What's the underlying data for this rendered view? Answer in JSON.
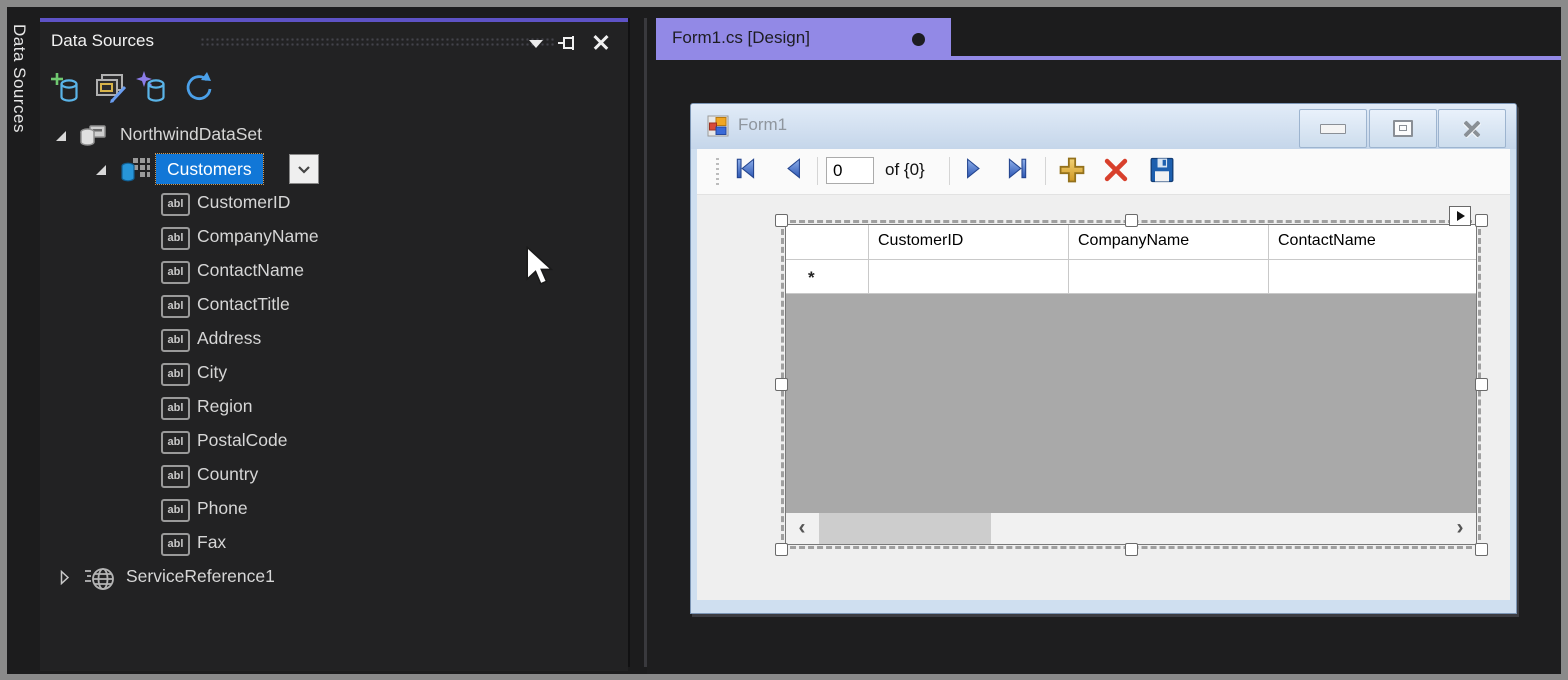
{
  "accent": {
    "panel_top_border": "#5e53c6",
    "tab_purple": "#9289e6",
    "selection_blue": "#1177d7"
  },
  "left_rail": {
    "vertical_tab_label": "Data Sources"
  },
  "panel": {
    "title": "Data Sources",
    "header_icons": [
      "chevron-down-icon",
      "pin-icon",
      "close-icon"
    ],
    "toolbar_icons": [
      "add-data-source-icon",
      "edit-dataset-designer-icon",
      "configure-wizard-icon",
      "refresh-icon"
    ],
    "tree": {
      "dataset_label": "NorthwindDataSet",
      "table_label": "Customers",
      "field_icon_text": "abl",
      "fields": [
        "CustomerID",
        "CompanyName",
        "ContactName",
        "ContactTitle",
        "Address",
        "City",
        "Region",
        "PostalCode",
        "Country",
        "Phone",
        "Fax"
      ],
      "service_label": "ServiceReference1"
    }
  },
  "editor": {
    "tab_label": "Form1.cs [Design]",
    "modified_indicator": "dot"
  },
  "form": {
    "title": "Form1",
    "window_icons": [
      "minimize-icon",
      "maximize-icon",
      "close-icon"
    ],
    "navigator": {
      "icons": [
        "move-first-icon",
        "move-previous-icon",
        "move-next-icon",
        "move-last-icon",
        "add-new-icon",
        "delete-icon",
        "save-icon"
      ],
      "position_value": "0",
      "count_label": "of {0}"
    },
    "grid": {
      "columns": [
        "CustomerID",
        "CompanyName",
        "ContactName"
      ],
      "new_row_marker": "*",
      "hscroll_left_glyph": "‹",
      "hscroll_right_glyph": "›"
    }
  }
}
